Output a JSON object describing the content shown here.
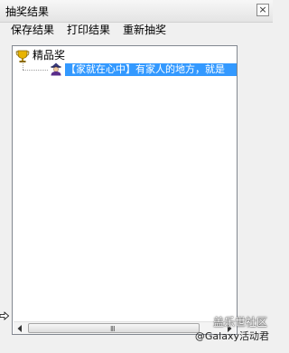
{
  "window": {
    "title": "抽奖结果",
    "close_glyph": "×"
  },
  "menu": {
    "items": [
      "保存结果",
      "打印结果",
      "重新抽奖"
    ]
  },
  "tree": {
    "root": {
      "label": "精品奖",
      "icon": "trophy-icon"
    },
    "children": [
      {
        "label": "【家就在心中】有家人的地方，就是",
        "icon": "user-avatar-icon",
        "selected": true
      }
    ]
  },
  "scrollbar": {
    "grip_glyph": "Ⅲ"
  },
  "watermark": {
    "line1": "盖乐世社区",
    "line2": "@Galaxy活动君"
  },
  "colors": {
    "selection": "#3399ff",
    "border": "#828790",
    "background": "#f0f0f0"
  }
}
